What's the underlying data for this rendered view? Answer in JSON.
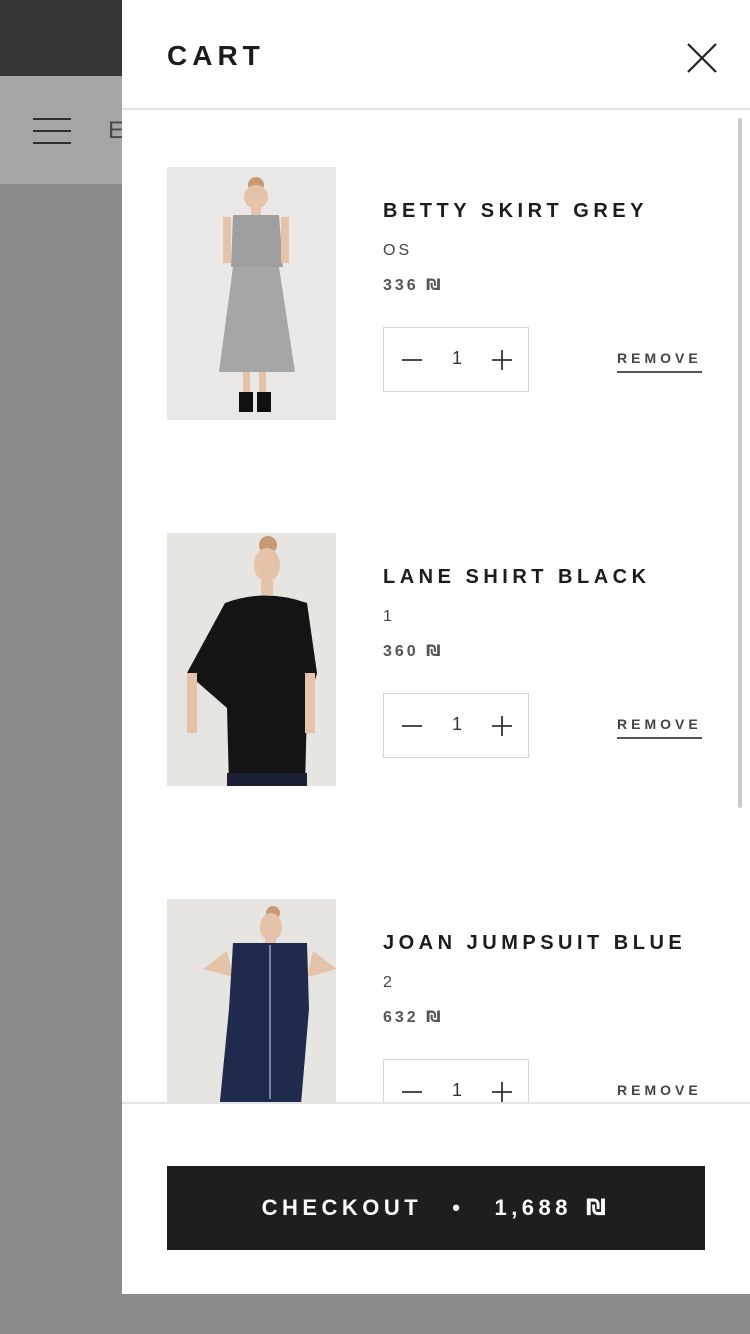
{
  "background": {
    "logo_initial": "E"
  },
  "cart": {
    "title": "CART",
    "items": [
      {
        "name": "BETTY SKIRT GREY",
        "variant": "OS",
        "price": "336",
        "currency": "₪",
        "quantity": "1",
        "remove_label": "REMOVE",
        "image": "grey-skirt-model"
      },
      {
        "name": "LANE SHIRT BLACK",
        "variant": "1",
        "price": "360",
        "currency": "₪",
        "quantity": "1",
        "remove_label": "REMOVE",
        "image": "black-shirt-model"
      },
      {
        "name": "JOAN JUMPSUIT BLUE",
        "variant": "2",
        "price": "632",
        "currency": "₪",
        "quantity": "1",
        "remove_label": "REMOVE",
        "image": "blue-jumpsuit-model"
      }
    ],
    "checkout": {
      "label": "CHECKOUT",
      "separator": "•",
      "total": "1,688",
      "currency": "₪"
    }
  },
  "colors": {
    "accent": "#1e1e1e",
    "overlay": "#8b8b8b",
    "grey_garment": "#9f9f9f",
    "black_garment": "#141414",
    "blue_garment": "#1f2a4d"
  },
  "icons": {
    "menu": "menu-icon",
    "close": "close-icon",
    "minus": "minus-icon",
    "plus": "plus-icon"
  }
}
